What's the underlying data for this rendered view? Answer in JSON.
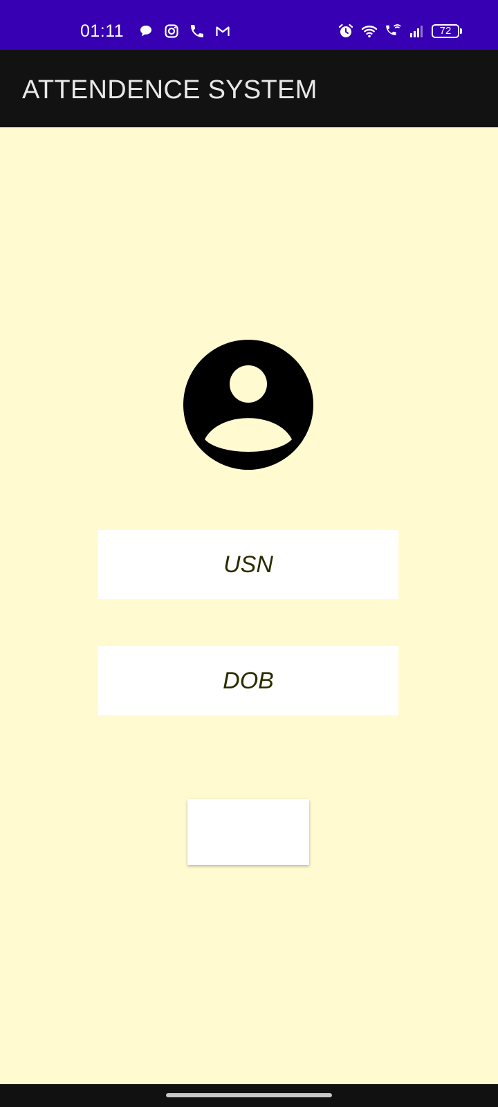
{
  "status_bar": {
    "time": "01:11",
    "battery_level": "72",
    "left_icons": [
      "chat-bubble-icon",
      "instagram-icon",
      "phone-icon",
      "gmail-icon"
    ],
    "right_icons": [
      "alarm-icon",
      "wifi-icon",
      "wifi-calling-icon",
      "signal-icon",
      "battery-icon"
    ],
    "background_color": "#3700b3"
  },
  "app_bar": {
    "title": "ATTENDENCE SYSTEM",
    "background_color": "#121212"
  },
  "form": {
    "avatar_icon": "account-circle-icon",
    "usn": {
      "placeholder": "USN",
      "value": ""
    },
    "dob": {
      "placeholder": "DOB",
      "value": ""
    },
    "submit_label": ""
  },
  "colors": {
    "page_background": "#fffad0",
    "field_background": "#ffffff",
    "field_text": "#2b2b00"
  }
}
